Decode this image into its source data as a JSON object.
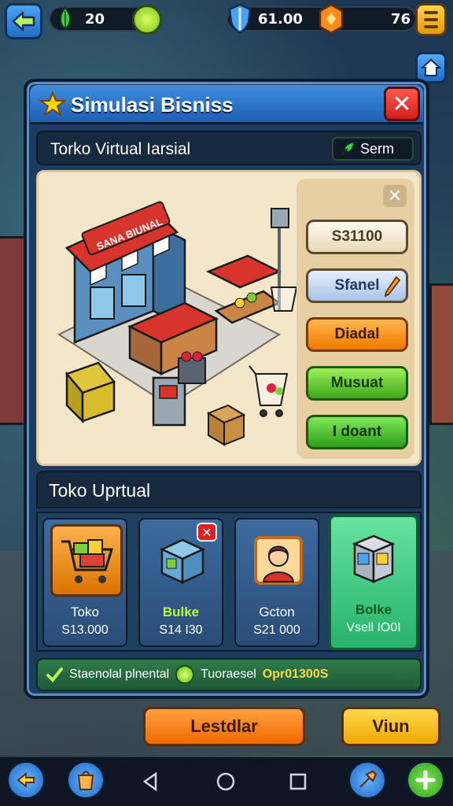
{
  "top_bar": {
    "energy_value": "20",
    "shield_value": "61.00",
    "coin_value": "76"
  },
  "dialog": {
    "title": "Simulasi Bisniss",
    "close_label": "✕",
    "subtitle": "Torko Virtual Iarsial",
    "search_label": "Serm"
  },
  "scene": {
    "shop_sign": "SANA BIUNAL",
    "panel_close_label": "✕",
    "buttons": [
      {
        "label": "S31100"
      },
      {
        "label": "Sfanel"
      },
      {
        "label": "Diadal"
      },
      {
        "label": "Musuat"
      },
      {
        "label": "I doant"
      }
    ]
  },
  "shop": {
    "title": "Toko Uprtual",
    "items": [
      {
        "name": "Toko",
        "price": "S13.000"
      },
      {
        "name": "Bulke",
        "price": "S14 I30"
      },
      {
        "name": "Gcton",
        "price": "S21 000"
      },
      {
        "name": "Bolke",
        "price": "Vsell IO0I"
      }
    ]
  },
  "status": {
    "text_1": "Staenolal plnental",
    "text_2": "Tuoraesel",
    "code": "Opr01300S"
  },
  "bottom": {
    "left_button": "Lestdlar",
    "right_button": "Viun"
  },
  "colors": {
    "dialog_header": "#3f8de0",
    "accent_orange": "#f06a00",
    "accent_green": "#3ea81a",
    "close_red": "#d41e1e"
  },
  "icons": [
    "back-arrow-icon",
    "leaf-icon",
    "gear-icon",
    "shield-icon",
    "coin-icon",
    "menu-icon",
    "home-icon",
    "star-icon",
    "close-icon",
    "leaf-search-icon",
    "pencil-icon",
    "check-icon",
    "ok-icon",
    "back-icon",
    "circle-home-icon",
    "square-recent-icon"
  ]
}
